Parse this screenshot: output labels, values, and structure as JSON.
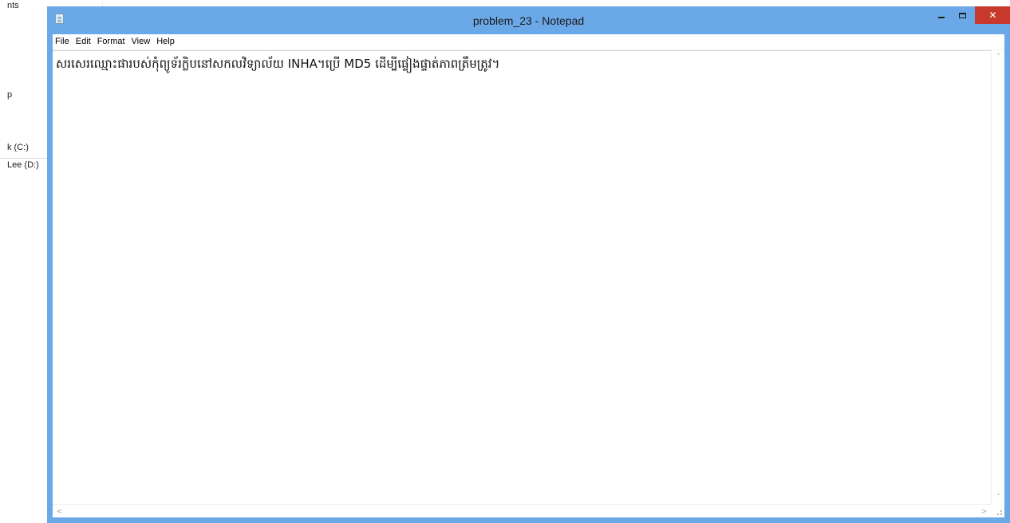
{
  "background": {
    "sidebar_items": [
      {
        "label": "nts"
      },
      {
        "label": "p"
      },
      {
        "label": "k (C:)"
      },
      {
        "label": "Lee (D:)"
      }
    ]
  },
  "window": {
    "title": "problem_23 - Notepad",
    "controls": {
      "minimize_icon": "minimize-icon",
      "maximize_icon": "maximize-icon",
      "close_label": "✕"
    },
    "menu": [
      {
        "label": "File"
      },
      {
        "label": "Edit"
      },
      {
        "label": "Format"
      },
      {
        "label": "View"
      },
      {
        "label": "Help"
      }
    ],
    "editor": {
      "content": "សរសេរឈ្មោះផារបស់កុំព្យូទ័រក្លិបនៅសកលវិទ្យាល័យ INHA។ប្រើ MD5 ដើម្បីផ្ទៀងផ្ទាត់ភាពត្រឹមត្រូវ។"
    },
    "scrollbars": {
      "up_arrow": "˄",
      "down_arrow": "˅",
      "left_arrow": "<",
      "right_arrow": ">"
    }
  },
  "colors": {
    "title_bar": "#6aa8e8",
    "close_button": "#c7392b"
  }
}
